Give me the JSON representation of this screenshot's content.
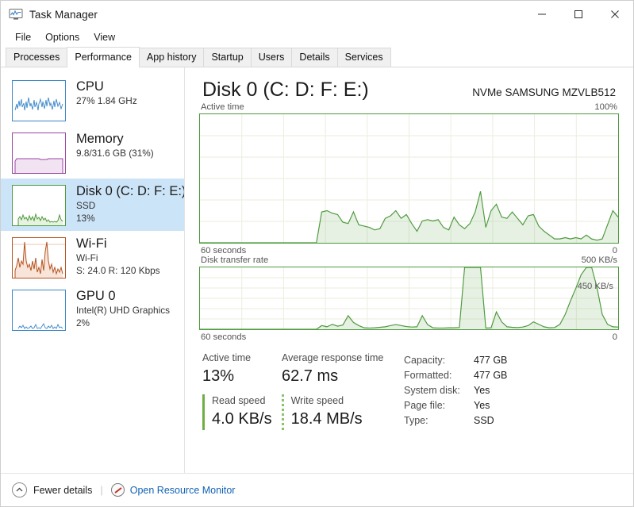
{
  "window": {
    "title": "Task Manager",
    "icon": "task-manager-icon",
    "buttons": {
      "minimize": "─",
      "maximize": "☐",
      "close": "✕"
    }
  },
  "menu": {
    "items": [
      "File",
      "Options",
      "View"
    ]
  },
  "tabs": {
    "items": [
      "Processes",
      "Performance",
      "App history",
      "Startup",
      "Users",
      "Details",
      "Services"
    ],
    "active": "Performance"
  },
  "sidebar": {
    "items": [
      {
        "title": "CPU",
        "sub1": "27%  1.84 GHz",
        "sub2": "",
        "color": "#3b87c9",
        "selected": false
      },
      {
        "title": "Memory",
        "sub1": "9.8/31.6 GB (31%)",
        "sub2": "",
        "color": "#9a45a0",
        "selected": false
      },
      {
        "title": "Disk 0 (C: D: F: E:)",
        "sub1": "SSD",
        "sub2": "13%",
        "color": "#4e9a3e",
        "selected": true
      },
      {
        "title": "Wi-Fi",
        "sub1": "Wi-Fi",
        "sub2": "S: 24.0 R: 120 Kbps",
        "color": "#b5521f",
        "selected": false
      },
      {
        "title": "GPU 0",
        "sub1": "Intel(R) UHD Graphics",
        "sub2": "2%",
        "color": "#3b87c9",
        "selected": false
      }
    ]
  },
  "main": {
    "title": "Disk 0 (C: D: F: E:)",
    "model": "NVMe SAMSUNG MZVLB512",
    "graph1": {
      "label": "Active time",
      "max_label": "100%",
      "axis_left": "60 seconds",
      "axis_right": "0"
    },
    "graph2": {
      "label": "Disk transfer rate",
      "max_label": "500 KB/s",
      "inner_label": "450 KB/s",
      "axis_left": "60 seconds",
      "axis_right": "0"
    },
    "stats": {
      "active_time_label": "Active time",
      "active_time_value": "13%",
      "avg_response_label": "Average response time",
      "avg_response_value": "62.7 ms",
      "read_speed_label": "Read speed",
      "read_speed_value": "4.0 KB/s",
      "write_speed_label": "Write speed",
      "write_speed_value": "18.4 MB/s",
      "details": [
        {
          "k": "Capacity:",
          "v": "477 GB"
        },
        {
          "k": "Formatted:",
          "v": "477 GB"
        },
        {
          "k": "System disk:",
          "v": "Yes"
        },
        {
          "k": "Page file:",
          "v": "Yes"
        },
        {
          "k": "Type:",
          "v": "SSD"
        }
      ]
    }
  },
  "footer": {
    "fewer_details": "Fewer details",
    "resource_monitor": "Open Resource Monitor"
  },
  "chart_data": [
    {
      "type": "area",
      "title": "Active time",
      "ylabel": "",
      "xlabel": "60 seconds",
      "ylim": [
        0,
        100
      ],
      "xlim": [
        60,
        0
      ],
      "grid": true,
      "color": "#4e9a3e",
      "values": [
        0,
        0,
        0,
        0,
        0,
        0,
        0,
        0,
        0,
        0,
        0,
        0,
        0,
        0,
        0,
        0,
        0,
        0,
        0,
        0,
        0,
        0,
        0,
        24,
        25,
        23,
        22,
        16,
        15,
        24,
        14,
        13,
        12,
        10,
        11,
        19,
        21,
        25,
        19,
        22,
        15,
        9,
        17,
        18,
        17,
        18,
        12,
        10,
        20,
        14,
        11,
        15,
        24,
        40,
        12,
        25,
        30,
        20,
        19,
        24,
        19,
        14,
        21,
        22,
        13,
        9,
        6,
        3,
        3,
        4,
        3,
        4,
        3,
        6,
        3,
        2,
        3,
        14,
        25,
        20
      ]
    },
    {
      "type": "area",
      "title": "Disk transfer rate",
      "ylabel": "",
      "xlabel": "60 seconds",
      "ylim": [
        0,
        500
      ],
      "xlim": [
        60,
        0
      ],
      "grid": true,
      "color": "#4e9a3e",
      "annotation": "450 KB/s",
      "values": [
        0,
        0,
        0,
        0,
        0,
        0,
        0,
        0,
        0,
        0,
        0,
        0,
        0,
        0,
        0,
        0,
        0,
        0,
        0,
        0,
        0,
        0,
        0,
        30,
        20,
        40,
        25,
        35,
        110,
        55,
        30,
        12,
        10,
        12,
        16,
        20,
        30,
        38,
        30,
        22,
        18,
        20,
        110,
        38,
        12,
        10,
        10,
        12,
        12,
        14,
        500,
        500,
        500,
        500,
        10,
        12,
        140,
        60,
        20,
        16,
        14,
        18,
        30,
        60,
        40,
        20,
        12,
        14,
        40,
        120,
        230,
        330,
        440,
        500,
        500,
        340,
        120,
        40,
        20,
        18
      ]
    }
  ]
}
